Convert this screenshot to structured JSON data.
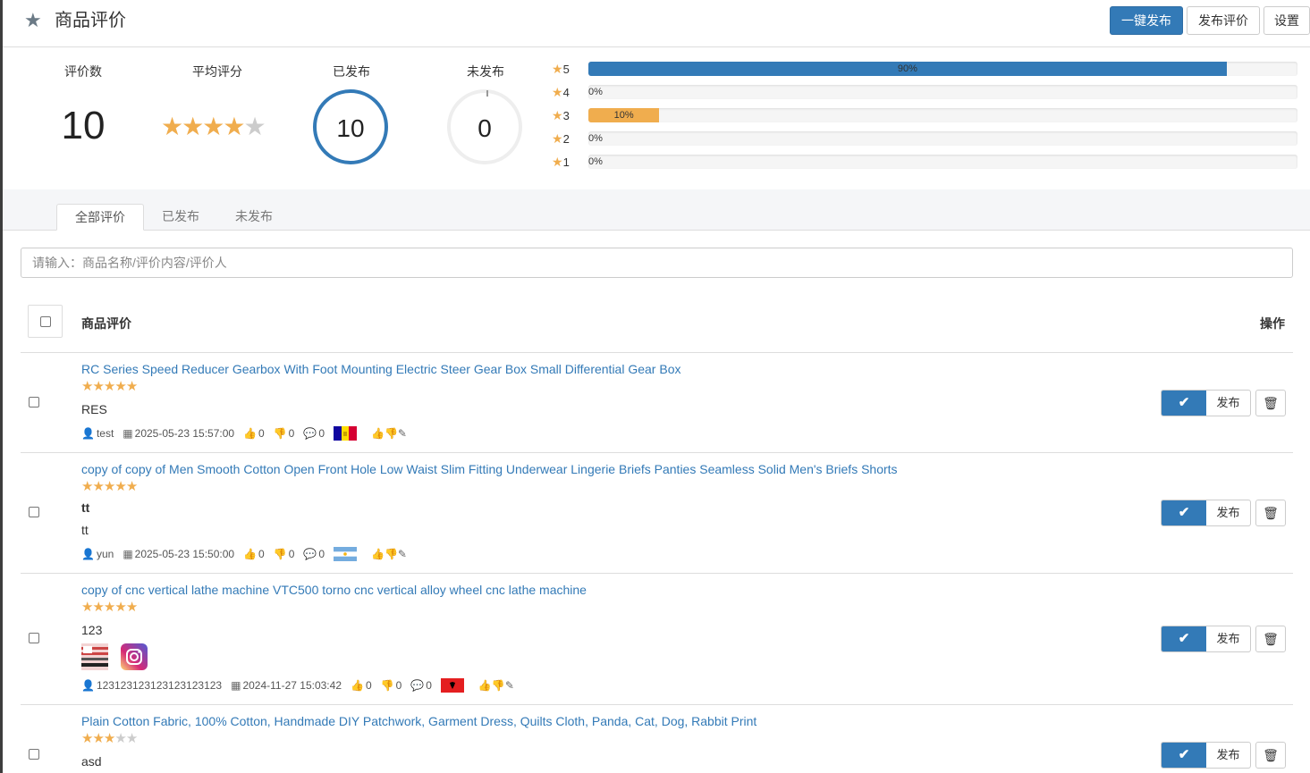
{
  "header": {
    "title": "商品评价",
    "btn_publish_all": "一键发布",
    "btn_post_review": "发布评价",
    "btn_settings": "设置"
  },
  "stats": {
    "count_label": "评价数",
    "count_value": "10",
    "avg_label": "平均评分",
    "avg_stars": 4,
    "published_label": "已发布",
    "published_value": "10",
    "unpublished_label": "未发布",
    "unpublished_value": "0"
  },
  "rating_bars": [
    {
      "star": "5",
      "percent_text": "90%",
      "fraction": 0.9,
      "color": "#337ab7"
    },
    {
      "star": "4",
      "percent_text": "0%",
      "fraction": 0,
      "color": "#337ab7"
    },
    {
      "star": "3",
      "percent_text": "10%",
      "fraction": 0.1,
      "color": "#f0ad4e"
    },
    {
      "star": "2",
      "percent_text": "0%",
      "fraction": 0,
      "color": "#337ab7"
    },
    {
      "star": "1",
      "percent_text": "0%",
      "fraction": 0,
      "color": "#337ab7"
    }
  ],
  "tabs": [
    "全部评价",
    "已发布",
    "未发布"
  ],
  "search": {
    "placeholder": "请输入：商品名称/评价内容/评价人"
  },
  "table": {
    "col_review": "商品评价",
    "col_action": "操作"
  },
  "actions": {
    "publish_label": "发布"
  },
  "reviews": [
    {
      "product": "RC Series Speed Reducer Gearbox With Foot Mounting Electric Steer Gear Box Small Differential Gear Box",
      "stars": 5,
      "title": "",
      "body": "RES",
      "author": "test",
      "date": "2025-05-23 15:57:00",
      "likes": "0",
      "dislikes": "0",
      "comments": "0",
      "flag": "andorra"
    },
    {
      "product": "copy of copy of Men Smooth Cotton Open Front Hole Low Waist Slim Fitting Underwear Lingerie Briefs Panties Seamless Solid Men's Briefs Shorts",
      "stars": 5,
      "title": "tt",
      "body": "tt",
      "author": "yun",
      "date": "2025-05-23 15:50:00",
      "likes": "0",
      "dislikes": "0",
      "comments": "0",
      "flag": "argentina"
    },
    {
      "product": "copy of cnc vertical lathe machine VTC500 torno cnc vertical alloy wheel cnc lathe machine",
      "stars": 5,
      "title": "",
      "body": "123",
      "author": "123123123123123123123",
      "date": "2024-11-27 15:03:42",
      "likes": "0",
      "dislikes": "0",
      "comments": "0",
      "flag": "albania"
    },
    {
      "product": "Plain Cotton Fabric, 100% Cotton, Handmade DIY Patchwork, Garment Dress, Quilts Cloth, Panda, Cat, Dog, Rabbit Print",
      "stars": 3,
      "title": "",
      "body": "asd",
      "author": "",
      "date": "",
      "likes": "",
      "dislikes": "",
      "comments": "",
      "flag": ""
    }
  ]
}
